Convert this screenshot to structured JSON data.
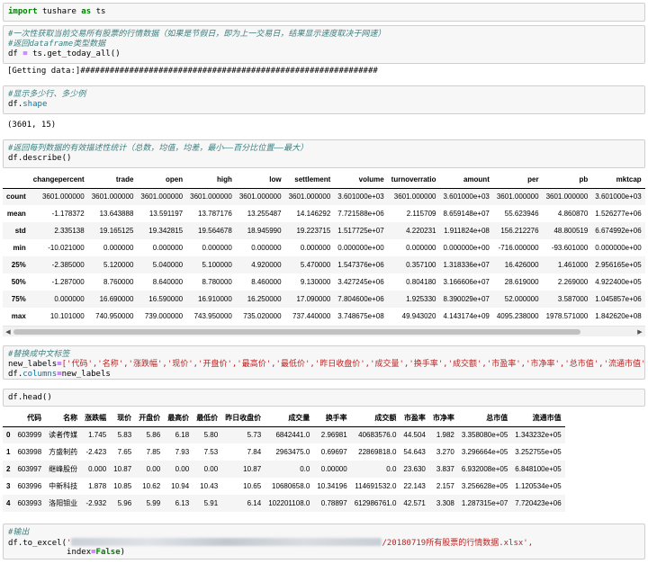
{
  "cells": {
    "import": {
      "kw1": "import",
      "mod": "tushare",
      "kw2": "as",
      "alias": "ts"
    },
    "fetch": {
      "comment1": "#一次性获取当前交易所有股票的行情数据（如果是节假日，即为上一交易日，结果显示速度取决于网速）",
      "comment2": "#返回dataframe类型数据",
      "code_var": "df",
      "code_op": "=",
      "code_call": "ts.get_today_all()",
      "output": "[Getting data:]#############################################################"
    },
    "shape": {
      "comment": "#显示多少行、多少例",
      "code_obj": "df.",
      "code_attr": "shape",
      "output": "(3601, 15)"
    },
    "describe": {
      "comment": "#返回每列数据的有效描述性统计（总数，均值，均差，最小——百分比位置——最大）",
      "code": "df.describe()"
    },
    "rename": {
      "comment": "#替换成中文标签",
      "line1_var": "new_labels",
      "line1_op": "=",
      "line1_list": "['代码','名称','涨跌幅','现价','开盘价','最高价','最低价','昨日收盘价','成交量','换手率','成交额','市盈率','市净率','总市值','流通市值']",
      "line2_obj": "df.",
      "line2_attr": "columns",
      "line2_op": "=",
      "line2_val": "new_labels"
    },
    "head": {
      "code": "df.head()"
    },
    "export": {
      "comment": "#输出",
      "line1_call": "df.to_excel(",
      "line1_quote": "'",
      "line1_str_end": "/20180719所有股票的行情数据.xlsx',",
      "line2_kw": "index",
      "line2_op": "=",
      "line2_val": "False",
      "line2_end": ")"
    }
  },
  "describe_table": {
    "columns": [
      "",
      "changepercent",
      "trade",
      "open",
      "high",
      "low",
      "settlement",
      "volume",
      "turnoverratio",
      "amount",
      "per",
      "pb",
      "mktcap"
    ],
    "rows": [
      [
        "count",
        "3601.000000",
        "3601.000000",
        "3601.000000",
        "3601.000000",
        "3601.000000",
        "3601.000000",
        "3.601000e+03",
        "3601.000000",
        "3.601000e+03",
        "3601.000000",
        "3601.000000",
        "3.601000e+03"
      ],
      [
        "mean",
        "-1.178372",
        "13.643888",
        "13.591197",
        "13.787176",
        "13.255487",
        "14.146292",
        "7.721588e+06",
        "2.115709",
        "8.659148e+07",
        "55.623946",
        "4.860870",
        "1.526277e+06"
      ],
      [
        "std",
        "2.335138",
        "19.165125",
        "19.342815",
        "19.564678",
        "18.945990",
        "19.223715",
        "1.517725e+07",
        "4.220231",
        "1.911824e+08",
        "156.212276",
        "48.800519",
        "6.674992e+06"
      ],
      [
        "min",
        "-10.021000",
        "0.000000",
        "0.000000",
        "0.000000",
        "0.000000",
        "0.000000",
        "0.000000e+00",
        "0.000000",
        "0.000000e+00",
        "-716.000000",
        "-93.601000",
        "0.000000e+00"
      ],
      [
        "25%",
        "-2.385000",
        "5.120000",
        "5.040000",
        "5.100000",
        "4.920000",
        "5.470000",
        "1.547376e+06",
        "0.357100",
        "1.318336e+07",
        "16.426000",
        "1.461000",
        "2.956165e+05"
      ],
      [
        "50%",
        "-1.287000",
        "8.760000",
        "8.640000",
        "8.780000",
        "8.460000",
        "9.130000",
        "3.427245e+06",
        "0.804180",
        "3.166606e+07",
        "28.619000",
        "2.269000",
        "4.922400e+05"
      ],
      [
        "75%",
        "0.000000",
        "16.690000",
        "16.590000",
        "16.910000",
        "16.250000",
        "17.090000",
        "7.804600e+06",
        "1.925330",
        "8.390029e+07",
        "52.000000",
        "3.587000",
        "1.045857e+06"
      ],
      [
        "max",
        "10.101000",
        "740.950000",
        "739.000000",
        "743.950000",
        "735.020000",
        "737.440000",
        "3.748675e+08",
        "49.943020",
        "4.143174e+09",
        "4095.238000",
        "1978.571000",
        "1.842620e+08"
      ]
    ]
  },
  "head_table": {
    "columns": [
      "",
      "代码",
      "名称",
      "涨跌幅",
      "现价",
      "开盘价",
      "最高价",
      "最低价",
      "昨日收盘价",
      "成交量",
      "换手率",
      "成交额",
      "市盈率",
      "市净率",
      "总市值",
      "流通市值"
    ],
    "rows": [
      [
        "0",
        "603999",
        "读者传媒",
        "1.745",
        "5.83",
        "5.86",
        "6.18",
        "5.80",
        "5.73",
        "6842441.0",
        "2.96981",
        "40683576.0",
        "44.504",
        "1.982",
        "3.358080e+05",
        "1.343232e+05"
      ],
      [
        "1",
        "603998",
        "方盛制药",
        "-2.423",
        "7.65",
        "7.85",
        "7.93",
        "7.53",
        "7.84",
        "2963475.0",
        "0.69697",
        "22869818.0",
        "54.643",
        "3.270",
        "3.296664e+05",
        "3.252755e+05"
      ],
      [
        "2",
        "603997",
        "继峰股份",
        "0.000",
        "10.87",
        "0.00",
        "0.00",
        "0.00",
        "10.87",
        "0.0",
        "0.00000",
        "0.0",
        "23.630",
        "3.837",
        "6.932008e+05",
        "6.848100e+05"
      ],
      [
        "3",
        "603996",
        "中新科技",
        "1.878",
        "10.85",
        "10.62",
        "10.94",
        "10.43",
        "10.65",
        "10680658.0",
        "10.34196",
        "114691532.0",
        "22.143",
        "2.157",
        "3.256628e+05",
        "1.120534e+05"
      ],
      [
        "4",
        "603993",
        "洛阳钼业",
        "-2.932",
        "5.96",
        "5.99",
        "6.13",
        "5.91",
        "6.14",
        "102201108.0",
        "0.78897",
        "612986761.0",
        "42.571",
        "3.308",
        "1.287315e+07",
        "7.720423e+06"
      ]
    ]
  }
}
